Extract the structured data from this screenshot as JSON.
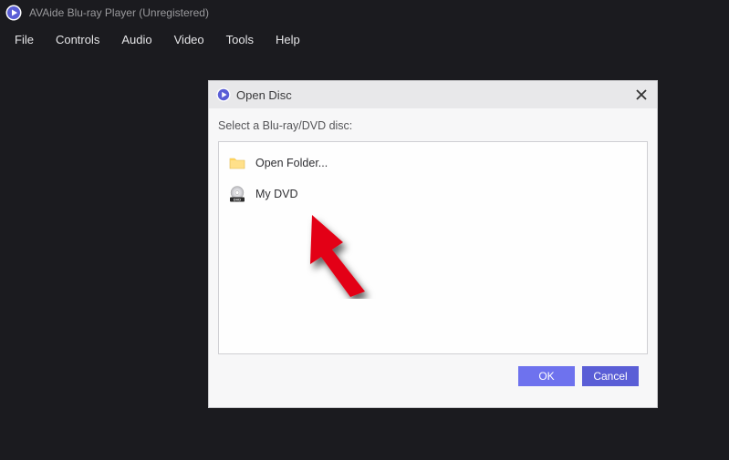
{
  "titlebar": {
    "title": "AVAide Blu-ray Player (Unregistered)"
  },
  "menubar": {
    "items": [
      "File",
      "Controls",
      "Audio",
      "Video",
      "Tools",
      "Help"
    ]
  },
  "dialog": {
    "title": "Open Disc",
    "instruction": "Select a Blu-ray/DVD disc:",
    "items": [
      {
        "icon": "folder-icon",
        "label": "Open Folder..."
      },
      {
        "icon": "dvd-icon",
        "label": "My DVD"
      }
    ],
    "buttons": {
      "ok": "OK",
      "cancel": "Cancel"
    }
  },
  "colors": {
    "accent": "#6e72ee",
    "titlebar_text": "#9a9a9d"
  }
}
